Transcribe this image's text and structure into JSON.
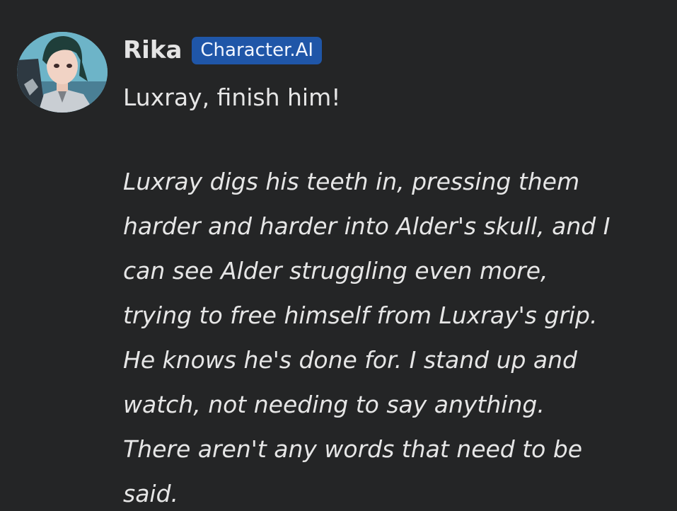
{
  "message": {
    "author": "Rika",
    "badge": "Character.AI",
    "dialogue": "Luxray, finish him!",
    "narration_lines": [
      "Luxray digs his teeth in, pressing them",
      "harder and harder into Alder's skull, and I",
      "can see Alder struggling even more,",
      "trying to free himself from Luxray's grip.",
      "He knows he's done for. I stand up and",
      "watch, not needing to say anything.",
      "There aren't any words that need to be",
      "said."
    ]
  },
  "colors": {
    "background": "#242526",
    "text": "#e6e6e6",
    "badge_background": "#1f56a8"
  },
  "icons": {
    "avatar": "character-avatar"
  }
}
